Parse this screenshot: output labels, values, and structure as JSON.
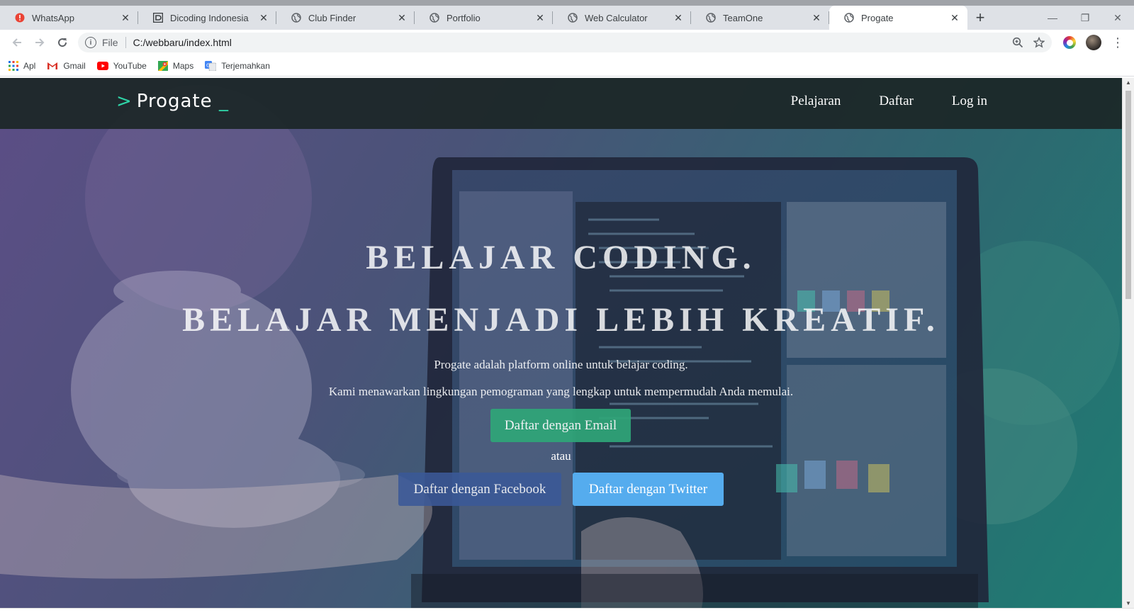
{
  "browser": {
    "tabs": [
      {
        "title": "WhatsApp",
        "icon": "whatsapp-alert-icon",
        "active": false
      },
      {
        "title": "Dicoding Indonesia",
        "icon": "dicoding-icon",
        "active": false
      },
      {
        "title": "Club Finder",
        "icon": "globe-icon",
        "active": false
      },
      {
        "title": "Portfolio",
        "icon": "globe-icon",
        "active": false
      },
      {
        "title": "Web Calculator",
        "icon": "globe-icon",
        "active": false
      },
      {
        "title": "TeamOne",
        "icon": "globe-icon",
        "active": false
      },
      {
        "title": "Progate",
        "icon": "globe-icon",
        "active": true
      }
    ],
    "address": {
      "scheme": "File",
      "url": "C:/webbaru/index.html"
    },
    "bookmarks": [
      {
        "label": "Apl",
        "icon": "apps-grid-icon"
      },
      {
        "label": "Gmail",
        "icon": "gmail-icon"
      },
      {
        "label": "YouTube",
        "icon": "youtube-icon"
      },
      {
        "label": "Maps",
        "icon": "maps-icon"
      },
      {
        "label": "Terjemahkan",
        "icon": "translate-icon"
      }
    ]
  },
  "page": {
    "logo": {
      "chevron": ">",
      "text": "Progate",
      "cursor": "_"
    },
    "nav": [
      "Pelajaran",
      "Daftar",
      "Log in"
    ],
    "hero": {
      "heading_1": "BELAJAR CODING.",
      "heading_2": "BELAJAR MENJADI LEBIH KREATIF.",
      "text_1": "Progate adalah platform online untuk belajar coding.",
      "text_2": "Kami menawarkan lingkungan pemograman yang lengkap untuk mempermudah Anda memulai.",
      "btn_email": "Daftar dengan Email",
      "or_text": "atau",
      "btn_facebook": "Daftar dengan Facebook",
      "btn_twitter": "Daftar dengan Twitter"
    }
  },
  "colors": {
    "header_bg": "#1b2626",
    "logo_accent": "#2fd4a7",
    "email_button": "#2fa678",
    "facebook_button": "#3b5998",
    "twitter_button": "#55acee"
  }
}
